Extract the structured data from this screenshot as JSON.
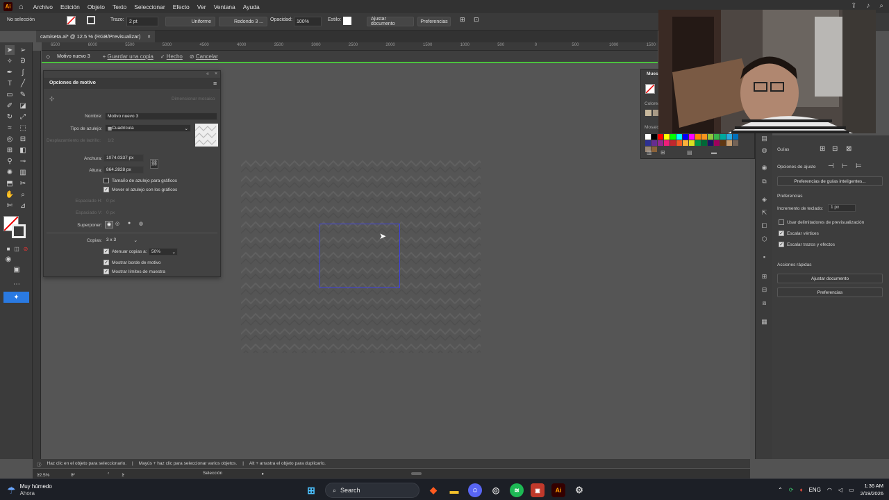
{
  "app": {
    "logo": "Ai",
    "home_icon": "home-icon"
  },
  "menu": [
    "Archivo",
    "Edición",
    "Objeto",
    "Texto",
    "Seleccionar",
    "Efecto",
    "Ver",
    "Ventana",
    "Ayuda"
  ],
  "control": {
    "selection": "No selección",
    "trazo_label": "Trazo:",
    "trazo_value": "2 pt",
    "profile": "Uniforme",
    "brush": "Redondo 3 ...",
    "opacity_label": "Opacidad:",
    "opacity_value": "100%",
    "style_label": "Estilo:",
    "fit_button": "Ajustar documento",
    "prefs_button": "Preferencias"
  },
  "doc_tab": {
    "title": "camiseta.ai* @ 12.5 % (RGB/Previsualizar)",
    "close": "×"
  },
  "ruler_ticks": [
    "6500",
    "6000",
    "5500",
    "5000",
    "4500",
    "4000",
    "3500",
    "3000",
    "2500",
    "2000",
    "1500",
    "1000",
    "500",
    "0",
    "500",
    "1000",
    "1500"
  ],
  "isolation": {
    "name": "Motivo nuevo 3",
    "save_copy": "Guardar una copia",
    "done": "Hecho",
    "cancel": "Cancelar"
  },
  "motif_panel": {
    "title": "Opciones de motivo",
    "fit_button": "Dimensionar mosaico",
    "name_label": "Nombre:",
    "name_value": "Motivo nuevo 3",
    "tile_type_label": "Tipo de azulejo:",
    "tile_type_value": "Cuadrícula",
    "offset_label": "Desplazamiento de ladrillo:",
    "offset_value": "1/2",
    "width_label": "Anchura:",
    "width_value": "1074.0337 px",
    "height_label": "Altura:",
    "height_value": "864.2828 px",
    "opt_size": "Tamaño de azulejo para gráficos",
    "opt_move": "Mover el azulejo con los gráficos",
    "space_h_label": "Espaciado H:",
    "space_h_value": "0 px",
    "space_v_label": "Espaciado V:",
    "space_v_value": "0 px",
    "overlap_label": "Superponer:",
    "copies_label": "Copias:",
    "copies_value": "3 x 3",
    "dim_label": "Atenuar copias a:",
    "dim_value": "50%",
    "show_border": "Mostrar borde de motivo",
    "show_limits": "Mostrar límites de muestra"
  },
  "swatches": {
    "title": "Mues",
    "colors_label": "Colores",
    "mosaic_label": "Mosaic"
  },
  "swatch_colors": [
    "#ffffff",
    "#000000",
    "#ff0000",
    "#ffff00",
    "#00ff00",
    "#00ffff",
    "#0000ff",
    "#ff00ff",
    "#ff8800",
    "#f7931e",
    "#8cc63f",
    "#39b54a",
    "#00a99d",
    "#29abe2",
    "#0071bc",
    "#2e3192",
    "#662d91",
    "#93278f",
    "#ed1e79",
    "#c1272d",
    "#f15a24",
    "#fbb03b",
    "#d9e021",
    "#009245",
    "#006837",
    "#1b1464",
    "#9e005d",
    "#603813",
    "#c69c6d",
    "#736357",
    "#998675",
    "#8b6239"
  ],
  "properties": {
    "guides_label": "Guías",
    "snap_label": "Opciones de ajuste",
    "smart_guides_button": "Preferencias de guías inteligentes...",
    "prefs_label": "Preferencias",
    "key_inc_label": "Incremento de teclado:",
    "key_inc_value": "1 px",
    "opt_preview": "Usar delimitadores de previsualización",
    "opt_corners": "Escalar vértices",
    "opt_strokes": "Escalar trazos y efectos",
    "quick_label": "Acciones rápidas",
    "fit_button": "Ajustar documento",
    "prefs_button": "Preferencias"
  },
  "status": {
    "hint1": "Haz clic en el objeto para seleccionarlo.",
    "hint2": "Mayús + haz clic para seleccionar varios objetos.",
    "hint3": "Alt + arrastra el objeto para duplicarlo.",
    "zoom": "12.5%",
    "angle": "0°",
    "artboard": "1",
    "mode": "Selección"
  },
  "taskbar": {
    "weather_title": "Muy húmedo",
    "weather_sub": "Ahora",
    "search": "Search",
    "lang": "ENG",
    "time": "1:36 AM",
    "date": "2/19/2026",
    "ai_label": "Ai"
  }
}
